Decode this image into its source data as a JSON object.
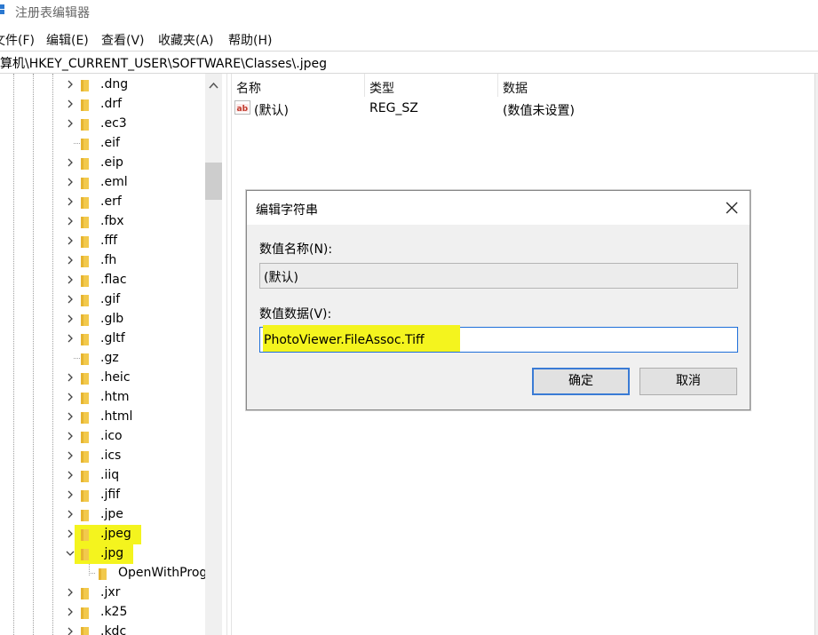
{
  "window": {
    "title": "注册表编辑器",
    "app_icon": "regedit-icon"
  },
  "menu": [
    "文件(F)",
    "编辑(E)",
    "查看(V)",
    "收藏夹(A)",
    "帮助(H)"
  ],
  "address": {
    "path": "计算机\\HKEY_CURRENT_USER\\SOFTWARE\\Classes\\.jpeg"
  },
  "tree": {
    "items": [
      {
        "label": ".dng",
        "expander": "collapsed"
      },
      {
        "label": ".drf",
        "expander": "collapsed"
      },
      {
        "label": ".ec3",
        "expander": "collapsed"
      },
      {
        "label": ".eif",
        "expander": "none"
      },
      {
        "label": ".eip",
        "expander": "collapsed"
      },
      {
        "label": ".eml",
        "expander": "collapsed"
      },
      {
        "label": ".erf",
        "expander": "collapsed"
      },
      {
        "label": ".fbx",
        "expander": "collapsed"
      },
      {
        "label": ".fff",
        "expander": "collapsed"
      },
      {
        "label": ".fh",
        "expander": "collapsed"
      },
      {
        "label": ".flac",
        "expander": "collapsed"
      },
      {
        "label": ".gif",
        "expander": "collapsed"
      },
      {
        "label": ".glb",
        "expander": "collapsed"
      },
      {
        "label": ".gltf",
        "expander": "collapsed"
      },
      {
        "label": ".gz",
        "expander": "none"
      },
      {
        "label": ".heic",
        "expander": "collapsed"
      },
      {
        "label": ".htm",
        "expander": "collapsed"
      },
      {
        "label": ".html",
        "expander": "collapsed"
      },
      {
        "label": ".ico",
        "expander": "collapsed"
      },
      {
        "label": ".ics",
        "expander": "collapsed"
      },
      {
        "label": ".iiq",
        "expander": "collapsed"
      },
      {
        "label": ".jfif",
        "expander": "collapsed"
      },
      {
        "label": ".jpe",
        "expander": "collapsed"
      },
      {
        "label": ".jpeg",
        "expander": "collapsed",
        "highlighted": true
      },
      {
        "label": ".jpg",
        "expander": "expanded",
        "highlighted": true
      },
      {
        "label": "OpenWithProgids",
        "expander": "child"
      },
      {
        "label": ".jxr",
        "expander": "collapsed"
      },
      {
        "label": ".k25",
        "expander": "collapsed"
      },
      {
        "label": ".kdc",
        "expander": "collapsed"
      }
    ]
  },
  "list": {
    "columns": [
      "名称",
      "类型",
      "数据"
    ],
    "rows": [
      {
        "name": "(默认)",
        "type": "REG_SZ",
        "data": "(数值未设置)",
        "icon": "string-value-icon"
      }
    ]
  },
  "dialog": {
    "title": "编辑字符串",
    "name_label": "数值名称(N):",
    "name_value": "(默认)",
    "data_label": "数值数据(V):",
    "data_value": "PhotoViewer.FileAssoc.Tiff",
    "ok_label": "确定",
    "cancel_label": "取消"
  },
  "colors": {
    "highlight": "#f4f41e",
    "folder": "#f2c94c",
    "focus": "#1e6fd9"
  }
}
